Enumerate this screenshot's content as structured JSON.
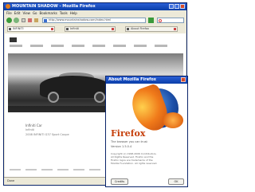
{
  "browser": {
    "title": "MOUNTAIN SHADOW - Mozilla Firefox",
    "menu": [
      "File",
      "Edit",
      "View",
      "Go",
      "Bookmarks",
      "Tools",
      "Help"
    ],
    "url": "http://www.mountainshadow.com/index.html",
    "tabs": [
      "INFINITI",
      "Infiniti",
      "About Firefox"
    ],
    "status": "Done"
  },
  "page": {
    "caption_title": "Infiniti Car",
    "caption_sub": "Infiniti",
    "caption_line": "2008 INFINITI G37 Sport Coupe"
  },
  "about_dialog": {
    "title": "About Mozilla Firefox",
    "product_name": "Firefox",
    "tagline": "The browser you can trust",
    "version": "Version 1.5.0.4",
    "credits": [
      "Copyright (c) 1998-2006 Contributors.",
      "All Rights Reserved. Firefox and the",
      "Firefox logos are trademarks of the",
      "Mozilla Foundation. All rights reserved."
    ],
    "credits_button": "Credits",
    "ok_button": "OK"
  },
  "colors": {
    "titlebar": "#0a3ea8",
    "firefox_orange": "#c6400c"
  },
  "icons": [
    "firefox-icon",
    "back-icon",
    "forward-icon",
    "reload-icon",
    "stop-icon",
    "home-icon",
    "go-icon",
    "search-icon",
    "close-icon"
  ]
}
